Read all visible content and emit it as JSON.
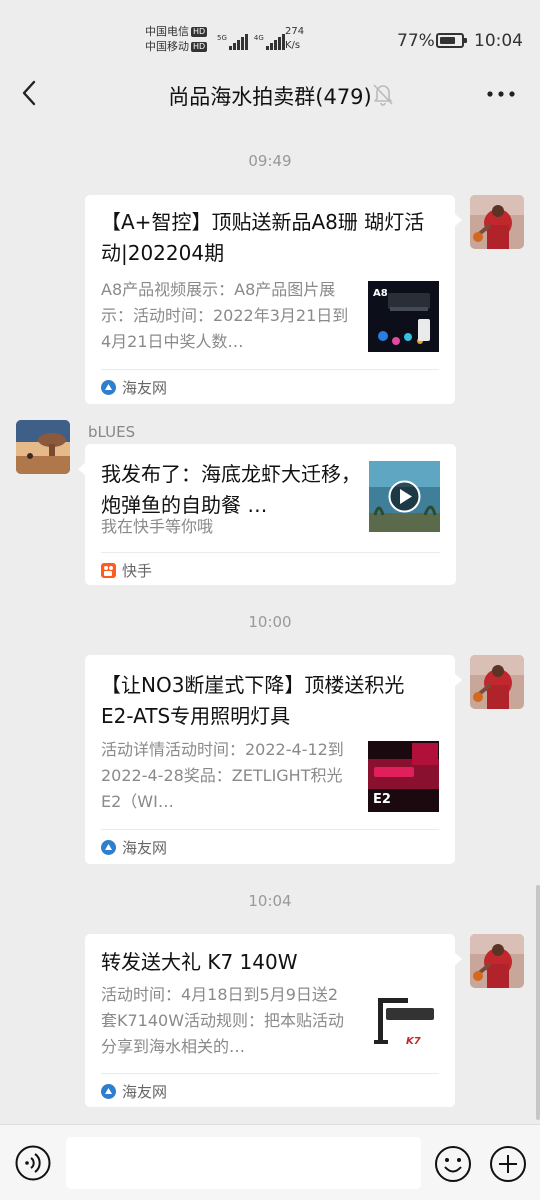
{
  "status_bar": {
    "carrier1": "中国电信",
    "carrier2": "中国移动",
    "hd": "HD",
    "net1": "5G",
    "net2": "4G",
    "speed_value": "274",
    "speed_unit": "K/s",
    "battery": "77%",
    "battery_level": 0.77,
    "time": "10:04"
  },
  "header": {
    "title": "尚品海水拍卖群(479)",
    "back_icon": "chevron-left-icon",
    "mute_icon": "bell-off-icon",
    "more_icon": "more-horizontal-icon"
  },
  "messages": [
    {
      "timestamp": "09:49",
      "sender": "",
      "title": "【A+智控】顶贴送新品A8珊 瑚灯活动|202204期",
      "desc": "A8产品视频展示：A8产品图片展示：活动时间：2022年3月21日到4月21日中奖人数…",
      "source": "海友网",
      "thumb_text": "A8"
    },
    {
      "timestamp": "",
      "sender": "bLUES",
      "title": "我发布了：海底龙虾大迁移，炮弹鱼的自助餐 …",
      "desc": "我在快手等你哦",
      "source": "快手",
      "thumb_text": ""
    },
    {
      "timestamp": "10:00",
      "sender": "",
      "title": "【让NO3断崖式下降】顶楼送积光E2-ATS专用照明灯具",
      "desc": "活动详情活动时间：2022-4-12到2022-4-28奖品：ZETLIGHT积光E2（WI…",
      "source": "海友网",
      "thumb_text": "E2"
    },
    {
      "timestamp": "10:04",
      "sender": "",
      "title": "转发送大礼 K7 140W",
      "desc": "活动时间：4月18日到5月9日送2套K7140W活动规则：把本贴活动分享到海水相关的…",
      "source": "海友网",
      "thumb_text": "K7"
    }
  ],
  "input_bar": {
    "placeholder": "",
    "voice_icon": "voice-icon",
    "emoji_icon": "emoji-icon",
    "plus_icon": "plus-icon"
  },
  "colors": {
    "background": "#ededed",
    "card": "#ffffff",
    "kuaishou": "#ff5a1f",
    "haiyou": "#2e7fd0"
  }
}
